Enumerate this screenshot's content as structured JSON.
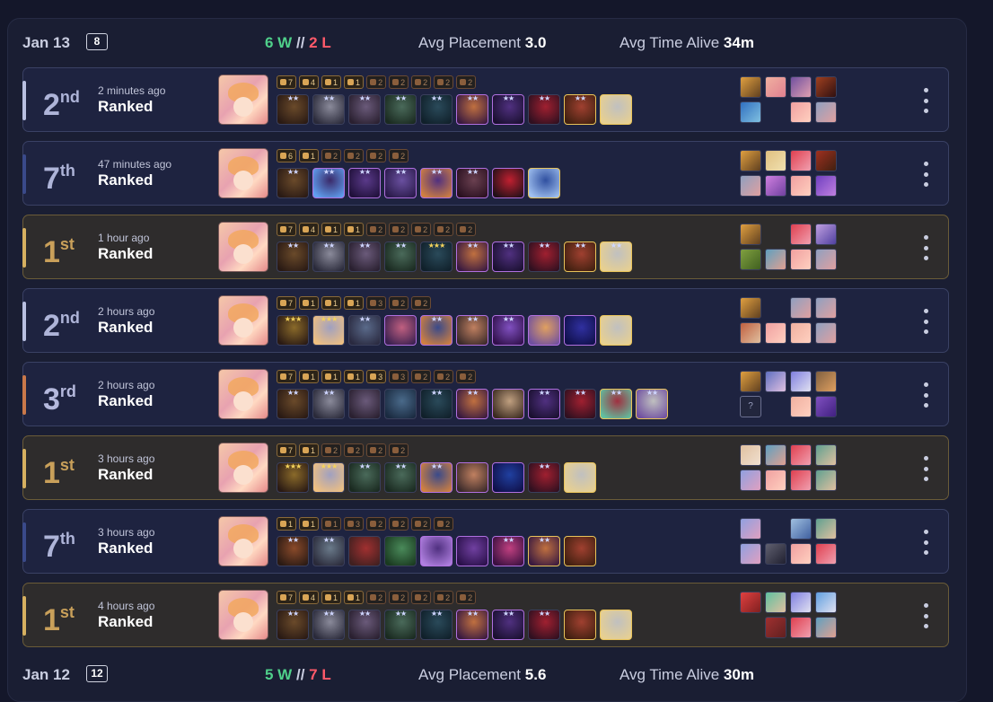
{
  "days": [
    {
      "date": "Jan 13",
      "count": "8",
      "wins": "6 W",
      "sep": "//",
      "losses": "2 L",
      "avg_label": "Avg Placement",
      "avg_value": "3.0",
      "time_label": "Avg Time Alive",
      "time_value": "34m"
    },
    {
      "date": "Jan 12",
      "count": "12",
      "wins": "5 W",
      "sep": "//",
      "losses": "7 L",
      "avg_label": "Avg Placement",
      "avg_value": "5.6",
      "time_label": "Avg Time Alive",
      "time_value": "30m"
    }
  ],
  "matches": [
    {
      "place": "2",
      "suffix": "nd",
      "ago": "2 minutes ago",
      "mode": "Ranked",
      "tier": "silver",
      "accent": "#b8bfe0",
      "traits": [
        [
          "7",
          0
        ],
        [
          "4",
          0
        ],
        [
          "1",
          0
        ],
        [
          "1",
          0
        ],
        [
          "2",
          1
        ],
        [
          "2",
          1
        ],
        [
          "2",
          1
        ],
        [
          "2",
          1
        ],
        [
          "2",
          1
        ]
      ],
      "units": [
        [
          "#6a4a2a",
          "#2a1a14",
          2,
          0
        ],
        [
          "#8a8a9a",
          "#2a2a3a",
          2,
          0
        ],
        [
          "#6a5a7a",
          "#2a2030",
          2,
          0
        ],
        [
          "#4a6a5a",
          "#1a2a20",
          2,
          0
        ],
        [
          "#2a4a5a",
          "#10202a",
          2,
          0
        ],
        [
          "#c07040",
          "#3a1a40",
          2,
          4
        ],
        [
          "#503080",
          "#1a1030",
          2,
          4
        ],
        [
          "#a02030",
          "#301020",
          2,
          0
        ],
        [
          "#a04030",
          "#402010",
          2,
          5
        ],
        [
          "#c0c0c0",
          "#e8d090",
          0,
          5
        ]
      ],
      "minis": [
        [
          "#e0a040",
          "#604020"
        ],
        [
          "#f0b0a0",
          "#e08090"
        ],
        [
          "#7050a0",
          "#e0a0b0"
        ],
        [
          "#a04020",
          "#301010"
        ],
        [
          "#3070c0",
          "#80c0e0"
        ],
        null,
        [
          "#f0a0a0",
          "#ffd0c0"
        ],
        [
          "#90a0c0",
          "#e0a0a0"
        ]
      ]
    },
    {
      "place": "7",
      "suffix": "th",
      "ago": "47 minutes ago",
      "mode": "Ranked",
      "tier": "blue",
      "accent": "#3a4a8a",
      "traits": [
        [
          "6",
          0
        ],
        [
          "1",
          0
        ],
        [
          "2",
          1
        ],
        [
          "2",
          1
        ],
        [
          "2",
          1
        ],
        [
          "2",
          1
        ]
      ],
      "units": [
        [
          "#6a4a2a",
          "#2a1a14",
          2,
          0
        ],
        [
          "#3a2a6a",
          "#60a0f0",
          2,
          4
        ],
        [
          "#5a3a8a",
          "#20103a",
          2,
          4
        ],
        [
          "#6a50a0",
          "#2a1a4a",
          2,
          4
        ],
        [
          "#503080",
          "#d08040",
          2,
          4
        ],
        [
          "#6a4050",
          "#2a1020",
          2,
          4
        ],
        [
          "#c02030",
          "#201018",
          0,
          4
        ],
        [
          "#3050a0",
          "#a0c0f0",
          0,
          5
        ]
      ],
      "minis": [
        [
          "#e0a040",
          "#604020"
        ],
        [
          "#e0c080",
          "#f0e0b0"
        ],
        [
          "#e04050",
          "#f0a0b0"
        ],
        [
          "#a03020",
          "#402010"
        ],
        [
          "#90a0c0",
          "#e0a0a0"
        ],
        [
          "#d080e0",
          "#7040a0"
        ],
        [
          "#f0a0a0",
          "#ffd0c0"
        ],
        [
          "#7040c0",
          "#c080e0"
        ]
      ]
    },
    {
      "place": "1",
      "suffix": "st",
      "ago": "1 hour ago",
      "mode": "Ranked",
      "tier": "gold",
      "accent": "#d6b060",
      "traits": [
        [
          "7",
          0
        ],
        [
          "4",
          0
        ],
        [
          "1",
          0
        ],
        [
          "1",
          0
        ],
        [
          "2",
          1
        ],
        [
          "2",
          1
        ],
        [
          "2",
          1
        ],
        [
          "2",
          1
        ],
        [
          "2",
          1
        ]
      ],
      "units": [
        [
          "#6a4a2a",
          "#2a1a14",
          2,
          0
        ],
        [
          "#8a8a9a",
          "#2a2a3a",
          2,
          0
        ],
        [
          "#6a5a7a",
          "#2a2030",
          2,
          0
        ],
        [
          "#4a6a5a",
          "#1a2a20",
          2,
          0
        ],
        [
          "#2a4a5a",
          "#10202a",
          3,
          0
        ],
        [
          "#c07040",
          "#3a1a40",
          2,
          4
        ],
        [
          "#503080",
          "#1a1030",
          2,
          4
        ],
        [
          "#a02030",
          "#301020",
          2,
          0
        ],
        [
          "#a04030",
          "#402010",
          2,
          5
        ],
        [
          "#c0c0c0",
          "#e8d090",
          2,
          5
        ]
      ],
      "minis": [
        [
          "#e0a040",
          "#604020"
        ],
        null,
        [
          "#e04050",
          "#f0a0b0"
        ],
        [
          "#c0a0e0",
          "#5040a0"
        ],
        [
          "#80a040",
          "#406020"
        ],
        [
          "#60a0c0",
          "#e0a090"
        ],
        [
          "#f0a0a0",
          "#ffd0c0"
        ],
        [
          "#90a0c0",
          "#e0a0a0"
        ]
      ]
    },
    {
      "place": "2",
      "suffix": "nd",
      "ago": "2 hours ago",
      "mode": "Ranked",
      "tier": "silver",
      "accent": "#b8bfe0",
      "traits": [
        [
          "7",
          0
        ],
        [
          "1",
          0
        ],
        [
          "1",
          0
        ],
        [
          "1",
          0
        ],
        [
          "3",
          1
        ],
        [
          "2",
          1
        ],
        [
          "2",
          1
        ]
      ],
      "units": [
        [
          "#8a6a2a",
          "#2a1a14",
          3,
          0
        ],
        [
          "#a0a0c0",
          "#f0c080",
          3,
          0
        ],
        [
          "#5a6a8a",
          "#2a2a40",
          2,
          0
        ],
        [
          "#c06080",
          "#3a2050",
          0,
          4
        ],
        [
          "#3a4a8a",
          "#d08040",
          2,
          4
        ],
        [
          "#c08060",
          "#3a2a2a",
          2,
          4
        ],
        [
          "#8050c0",
          "#30104a",
          2,
          4
        ],
        [
          "#e0a060",
          "#7050a0",
          0,
          4
        ],
        [
          "#3030a0",
          "#10104a",
          0,
          4
        ],
        [
          "#c0c0c0",
          "#e8d090",
          0,
          5
        ]
      ],
      "minis": [
        [
          "#e0a040",
          "#604020"
        ],
        null,
        [
          "#90a0c0",
          "#e0a0a0"
        ],
        [
          "#90a0c0",
          "#e0a0a0"
        ],
        [
          "#c06040",
          "#e0c0a0"
        ],
        [
          "#f0a0a0",
          "#ffd0c0"
        ],
        [
          "#f0b0a0",
          "#ffd0c0"
        ],
        [
          "#90a0c0",
          "#e0a0a0"
        ]
      ]
    },
    {
      "place": "3",
      "suffix": "rd",
      "ago": "2 hours ago",
      "mode": "Ranked",
      "tier": "bronze",
      "accent": "#c9784a",
      "traits": [
        [
          "7",
          0
        ],
        [
          "1",
          0
        ],
        [
          "1",
          0
        ],
        [
          "1",
          0
        ],
        [
          "3",
          0
        ],
        [
          "3",
          1
        ],
        [
          "2",
          1
        ],
        [
          "2",
          1
        ],
        [
          "2",
          1
        ]
      ],
      "units": [
        [
          "#6a4a2a",
          "#2a1a14",
          2,
          0
        ],
        [
          "#8a8a9a",
          "#2a2a3a",
          2,
          0
        ],
        [
          "#6a5a7a",
          "#2a2030",
          0,
          0
        ],
        [
          "#4a6a8a",
          "#1a2a40",
          0,
          0
        ],
        [
          "#2a4a5a",
          "#10202a",
          2,
          0
        ],
        [
          "#c07040",
          "#3a1a40",
          2,
          4
        ],
        [
          "#c0a080",
          "#3a2a20",
          0,
          4
        ],
        [
          "#503080",
          "#1a1030",
          2,
          4
        ],
        [
          "#a02030",
          "#301020",
          2,
          0
        ],
        [
          "#a03040",
          "#60c0a0",
          2,
          5
        ],
        [
          "#c0c0c0",
          "#7050a0",
          2,
          5
        ]
      ],
      "minis": [
        [
          "#e0a040",
          "#604020"
        ],
        [
          "#6070c0",
          "#e0c0e0"
        ],
        [
          "#8080e0",
          "#e0e0f0"
        ],
        [
          "#806040",
          "#e0a060"
        ],
        "q",
        null,
        [
          "#f0b0a0",
          "#ffd0c0"
        ],
        [
          "#8050c0",
          "#402080"
        ]
      ]
    },
    {
      "place": "1",
      "suffix": "st",
      "ago": "3 hours ago",
      "mode": "Ranked",
      "tier": "gold",
      "accent": "#d6b060",
      "traits": [
        [
          "7",
          0
        ],
        [
          "1",
          0
        ],
        [
          "2",
          1
        ],
        [
          "2",
          1
        ],
        [
          "2",
          1
        ],
        [
          "2",
          1
        ]
      ],
      "units": [
        [
          "#8a6a2a",
          "#2a1a14",
          3,
          0
        ],
        [
          "#a0a0c0",
          "#f0c080",
          3,
          0
        ],
        [
          "#4a6a5a",
          "#1a2a20",
          2,
          0
        ],
        [
          "#4a6a5a",
          "#1a2a20",
          2,
          0
        ],
        [
          "#3a4a8a",
          "#d08040",
          2,
          4
        ],
        [
          "#c08060",
          "#3a2a2a",
          0,
          4
        ],
        [
          "#2040a0",
          "#10104a",
          0,
          4
        ],
        [
          "#a02030",
          "#301020",
          2,
          0
        ],
        [
          "#c0c0c0",
          "#e8d090",
          0,
          5
        ]
      ],
      "minis": [
        [
          "#e0c0a0",
          "#f0e0d0"
        ],
        [
          "#60a0c0",
          "#e0a090"
        ],
        [
          "#e04050",
          "#f0a0b0"
        ],
        [
          "#60a090",
          "#e0c0a0"
        ],
        [
          "#90a0e0",
          "#e0a0c0"
        ],
        [
          "#f0a0a0",
          "#ffd0c0"
        ],
        [
          "#e04050",
          "#f0a0b0"
        ],
        [
          "#60a090",
          "#e0c0a0"
        ]
      ]
    },
    {
      "place": "7",
      "suffix": "th",
      "ago": "3 hours ago",
      "mode": "Ranked",
      "tier": "blue",
      "accent": "#3a4a8a",
      "traits": [
        [
          "1",
          0
        ],
        [
          "1",
          0
        ],
        [
          "1",
          1
        ],
        [
          "3",
          1
        ],
        [
          "2",
          1
        ],
        [
          "2",
          1
        ],
        [
          "2",
          1
        ],
        [
          "2",
          1
        ]
      ],
      "units": [
        [
          "#8a4a2a",
          "#2a1a14",
          2,
          0
        ],
        [
          "#6a7a8a",
          "#2a2a3a",
          2,
          0
        ],
        [
          "#a03030",
          "#402020",
          0,
          0
        ],
        [
          "#4a8a5a",
          "#1a3a20",
          0,
          0
        ],
        [
          "#503080",
          "#b080e0",
          0,
          4
        ],
        [
          "#7040a0",
          "#2a104a",
          0,
          4
        ],
        [
          "#c04080",
          "#3a1040",
          2,
          4
        ],
        [
          "#c07040",
          "#3a1a40",
          2,
          5
        ],
        [
          "#a04030",
          "#402010",
          0,
          5
        ]
      ],
      "minis": [
        [
          "#90a0e0",
          "#e0a0c0"
        ],
        null,
        [
          "#a0c0e0",
          "#4060a0"
        ],
        [
          "#60a090",
          "#e0c0a0"
        ],
        [
          "#90a0e0",
          "#e0a0c0"
        ],
        [
          "#606070",
          "#202030"
        ],
        [
          "#f0a0a0",
          "#ffd0c0"
        ],
        [
          "#e04050",
          "#f0a0b0"
        ]
      ]
    },
    {
      "place": "1",
      "suffix": "st",
      "ago": "4 hours ago",
      "mode": "Ranked",
      "tier": "gold",
      "accent": "#d6b060",
      "traits": [
        [
          "7",
          0
        ],
        [
          "4",
          0
        ],
        [
          "1",
          0
        ],
        [
          "1",
          0
        ],
        [
          "2",
          1
        ],
        [
          "2",
          1
        ],
        [
          "2",
          1
        ],
        [
          "2",
          1
        ],
        [
          "2",
          1
        ]
      ],
      "units": [
        [
          "#6a4a2a",
          "#2a1a14",
          2,
          0
        ],
        [
          "#8a8a9a",
          "#2a2a3a",
          2,
          0
        ],
        [
          "#6a5a7a",
          "#2a2030",
          2,
          0
        ],
        [
          "#4a6a5a",
          "#1a2a20",
          2,
          0
        ],
        [
          "#2a4a5a",
          "#10202a",
          2,
          0
        ],
        [
          "#c07040",
          "#3a1a40",
          2,
          4
        ],
        [
          "#503080",
          "#1a1030",
          2,
          4
        ],
        [
          "#a02030",
          "#301020",
          2,
          0
        ],
        [
          "#a04030",
          "#402010",
          0,
          5
        ],
        [
          "#c0c0c0",
          "#e8d090",
          0,
          5
        ]
      ],
      "minis": [
        [
          "#e04040",
          "#802020"
        ],
        [
          "#60c0a0",
          "#e0c0a0"
        ],
        [
          "#8080e0",
          "#e0e0f0"
        ],
        [
          "#60a0e0",
          "#e0e0f0"
        ],
        null,
        [
          "#a03030",
          "#602020"
        ],
        [
          "#e04050",
          "#f0a0b0"
        ],
        [
          "#60a0c0",
          "#e0a090"
        ]
      ]
    }
  ]
}
